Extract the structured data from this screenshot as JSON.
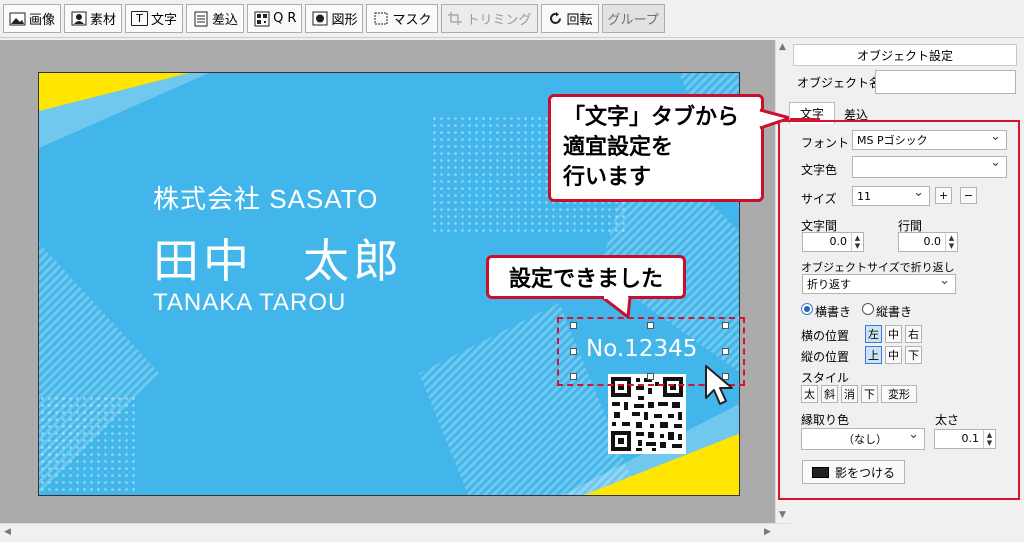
{
  "toolbar": {
    "image": "画像",
    "material": "素材",
    "text": "文字",
    "insert": "差込",
    "qr": "Q R",
    "shape": "図形",
    "mask": "マスク",
    "trimming": "トリミング",
    "rotate": "回転",
    "group": "グループ"
  },
  "card": {
    "company": "株式会社 SASATO",
    "name": "田中　太郎",
    "romaji": "TANAKA TAROU",
    "number": "No.12345",
    "colors": {
      "background": "#42b6ea",
      "accent": "#ffe600",
      "text": "#ffffff"
    }
  },
  "callouts": {
    "tab_hint": [
      "「文字」タブから",
      "適宜設定を",
      "行います"
    ],
    "done": "設定できました"
  },
  "panel": {
    "header": "オブジェクト設定",
    "object_name_label": "オブジェクト名",
    "object_name_value": "",
    "tabs": [
      "文字",
      "差込"
    ],
    "font_label": "フォント",
    "font_value": "MS Pゴシック",
    "color_label": "文字色",
    "size_label": "サイズ",
    "size_value": "11",
    "plus": "+",
    "minus": "−",
    "char_spacing_label": "文字間",
    "char_spacing_value": "0.0",
    "line_spacing_label": "行間",
    "line_spacing_value": "0.0",
    "wrap_label": "オブジェクトサイズで折り返し",
    "wrap_value": "折り返す",
    "horizontal_label": "横書き",
    "vertical_label": "縦書き",
    "hpos_label": "横の位置",
    "hpos_options": [
      "左",
      "中",
      "右"
    ],
    "vpos_label": "縦の位置",
    "vpos_options": [
      "上",
      "中",
      "下"
    ],
    "style_label": "スタイル",
    "style_options": [
      "太",
      "斜",
      "消",
      "下",
      "変形"
    ],
    "border_color_label": "縁取り色",
    "border_color_value": "（なし）",
    "thickness_label": "太さ",
    "thickness_value": "0.1",
    "shadow_button": "影をつける"
  }
}
